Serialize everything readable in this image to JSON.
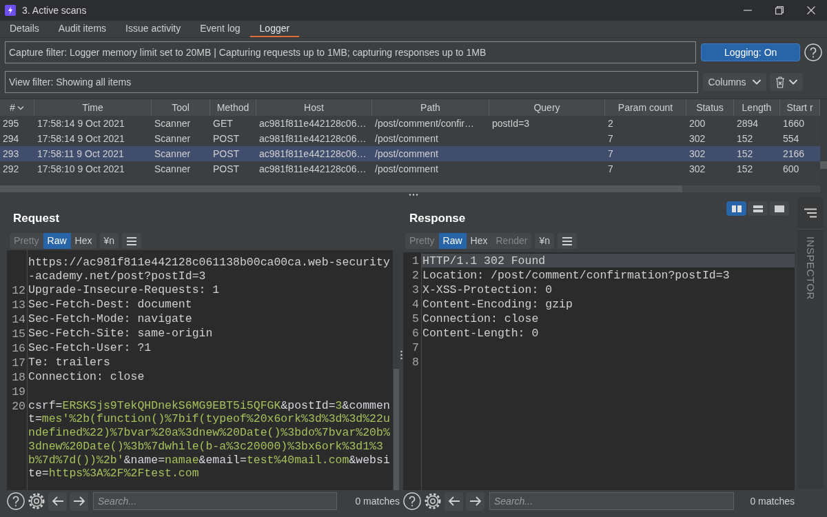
{
  "window": {
    "title": "3. Active scans"
  },
  "tabs": [
    {
      "label": "Details",
      "selected": false
    },
    {
      "label": "Audit items",
      "selected": false
    },
    {
      "label": "Issue activity",
      "selected": false
    },
    {
      "label": "Event log",
      "selected": false
    },
    {
      "label": "Logger",
      "selected": true
    }
  ],
  "capture_filter": {
    "value": "Capture filter: Logger memory limit set to 20MB | Capturing requests up to 1MB;  capturing responses up to 1MB"
  },
  "logging_button": {
    "label": "Logging: On",
    "on": true
  },
  "view_filter": {
    "value": "View filter: Showing all items"
  },
  "columns_button": {
    "label": "Columns"
  },
  "table": {
    "columns": [
      {
        "label": "#",
        "sorted": true
      },
      {
        "label": "Time",
        "sorted": false
      },
      {
        "label": "Tool",
        "sorted": false
      },
      {
        "label": "Method",
        "sorted": false
      },
      {
        "label": "Host",
        "sorted": false
      },
      {
        "label": "Path",
        "sorted": false
      },
      {
        "label": "Query",
        "sorted": false
      },
      {
        "label": "Param count",
        "sorted": false
      },
      {
        "label": "Status",
        "sorted": false
      },
      {
        "label": "Length",
        "sorted": false
      },
      {
        "label": "Start r",
        "sorted": false
      }
    ],
    "rows": [
      {
        "selected": false,
        "cells": [
          "295",
          "17:58:14 9 Oct 2021",
          "Scanner",
          "GET",
          "ac981f811e442128c06…",
          "/post/comment/confir…",
          "postId=3",
          "2",
          "200",
          "2894",
          "1660"
        ]
      },
      {
        "selected": false,
        "cells": [
          "294",
          "17:58:14 9 Oct 2021",
          "Scanner",
          "POST",
          "ac981f811e442128c06…",
          "/post/comment",
          null,
          "7",
          "302",
          "152",
          "554"
        ]
      },
      {
        "selected": true,
        "cells": [
          "293",
          "17:58:11 9 Oct 2021",
          "Scanner",
          "POST",
          "ac981f811e442128c06…",
          "/post/comment",
          null,
          "7",
          "302",
          "152",
          "2166"
        ]
      },
      {
        "selected": false,
        "cells": [
          "292",
          "17:58:10 9 Oct 2021",
          "Scanner",
          "POST",
          "ac981f811e442128c06…",
          "/post/comment",
          null,
          "7",
          "302",
          "152",
          "600"
        ]
      }
    ]
  },
  "request": {
    "title": "Request",
    "view_tabs": [
      {
        "label": "Pretty",
        "selected": false,
        "disabled": true
      },
      {
        "label": "Raw",
        "selected": true,
        "disabled": false
      },
      {
        "label": "Hex",
        "selected": false,
        "disabled": false
      }
    ],
    "newline_button": "¥n",
    "lines": [
      {
        "text": "https://ac981f811e442128c061138b00ca00ca.web-security-academy.net/post?postId=3"
      },
      {
        "number": "12",
        "text": "Upgrade-Insecure-Requests: 1"
      },
      {
        "number": "13",
        "text": "Sec-Fetch-Dest: document"
      },
      {
        "number": "14",
        "text": "Sec-Fetch-Mode: navigate"
      },
      {
        "number": "15",
        "text": "Sec-Fetch-Site: same-origin"
      },
      {
        "number": "16",
        "text": "Sec-Fetch-User: ?1"
      },
      {
        "number": "17",
        "text": "Te: trailers"
      },
      {
        "number": "18",
        "text": "Connection: close"
      },
      {
        "number": "19"
      },
      {
        "number": "20",
        "segments": [
          {
            "kind": "key",
            "text": "csrf="
          },
          {
            "kind": "value",
            "text": "ERSKSjs9TekQHDnekS6MG9EBT5i5QFGK"
          },
          {
            "kind": "key",
            "text": "&postId="
          },
          {
            "kind": "value",
            "text": "3"
          },
          {
            "kind": "key",
            "text": "&comment="
          },
          {
            "kind": "value",
            "text": "mes'%2b(function()%7bif(typeof%20x6ork%3d%3d%3d%22undefined%22)%7bvar%20a%3dnew%20Date()%3bdo%7bvar%20b%3dnew%20Date()%3b%7dwhile(b-a%3c20000)%3bx6ork%3d1%3b%7d%7d())%2b'"
          },
          {
            "kind": "key",
            "text": "&name="
          },
          {
            "kind": "value",
            "text": "namae"
          },
          {
            "kind": "key",
            "text": "&email="
          },
          {
            "kind": "value",
            "text": "test%40mail.com"
          },
          {
            "kind": "key",
            "text": "&website="
          },
          {
            "kind": "value",
            "text": "https%3A%2F%2Ftest.com"
          }
        ]
      }
    ],
    "search": {
      "placeholder": "Search..."
    },
    "matches": "0 matches"
  },
  "response": {
    "title": "Response",
    "layout_buttons": [
      {
        "selected": true
      },
      {
        "selected": false
      },
      {
        "selected": false
      }
    ],
    "view_tabs": [
      {
        "label": "Pretty",
        "selected": false,
        "disabled": true
      },
      {
        "label": "Raw",
        "selected": true,
        "disabled": false
      },
      {
        "label": "Hex",
        "selected": false,
        "disabled": false
      },
      {
        "label": "Render",
        "selected": false,
        "disabled": true
      }
    ],
    "newline_button": "¥n",
    "lines": [
      {
        "number": "1",
        "text": "HTTP/1.1 302 Found",
        "current": true
      },
      {
        "number": "2",
        "text": "Location: /post/comment/confirmation?postId=3",
        "current": false
      },
      {
        "number": "3",
        "text": "X-XSS-Protection: 0",
        "current": false
      },
      {
        "number": "4",
        "text": "Content-Encoding: gzip",
        "current": false
      },
      {
        "number": "5",
        "text": "Connection: close",
        "current": false
      },
      {
        "number": "6",
        "text": "Content-Length: 0",
        "current": false
      },
      {
        "number": "7",
        "current": false
      },
      {
        "number": "8",
        "current": false
      }
    ],
    "search": {
      "placeholder": "Search..."
    },
    "matches": "0 matches"
  },
  "inspector": {
    "label": "INSPECTOR"
  }
}
